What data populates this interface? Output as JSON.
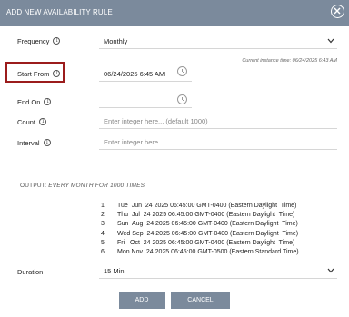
{
  "header": {
    "title": "ADD NEW AVAILABILITY RULE"
  },
  "frequency": {
    "label": "Frequency",
    "value": "Monthly"
  },
  "instance_hint": "Current instance time: 06/24/2025 6:43 AM",
  "start_from": {
    "label": "Start From",
    "value": "06/24/2025 6:45 AM"
  },
  "end_on": {
    "label": "End On",
    "value": ""
  },
  "count": {
    "label": "Count",
    "placeholder": "Enter integer here... (default 1000)"
  },
  "interval": {
    "label": "Interval",
    "placeholder": "Enter integer here..."
  },
  "output": {
    "prefix": "OUTPUT:",
    "text": "EVERY MONTH FOR 1000 TIMES"
  },
  "occurrences": [
    {
      "n": "1",
      "text": "Tue  Jun  24 2025 06:45:00 GMT-0400 (Eastern Daylight  Time)"
    },
    {
      "n": "2",
      "text": "Thu  Jul  24 2025 06:45:00 GMT-0400 (Eastern Daylight  Time)"
    },
    {
      "n": "3",
      "text": "Sun  Aug  24 2025 06:45:00 GMT-0400 (Eastern Daylight  Time)"
    },
    {
      "n": "4",
      "text": "Wed Sep  24 2025 06:45:00 GMT-0400 (Eastern Daylight  Time)"
    },
    {
      "n": "5",
      "text": "Fri   Oct  24 2025 06:45:00 GMT-0400 (Eastern Daylight  Time)"
    },
    {
      "n": "6",
      "text": "Mon Nov  24 2025 06:45:00 GMT-0500 (Eastern Standard Time)"
    }
  ],
  "duration": {
    "label": "Duration",
    "value": "15 Min"
  },
  "buttons": {
    "add": "ADD",
    "cancel": "CANCEL"
  },
  "colors": {
    "header": "#7b8a9c",
    "highlight": "#9b1c1c",
    "button": "#7b8a9c"
  },
  "icons": {
    "close": "close-circle-icon",
    "info": "info-icon",
    "clock": "clock-icon",
    "chevron": "chevron-down-icon"
  }
}
